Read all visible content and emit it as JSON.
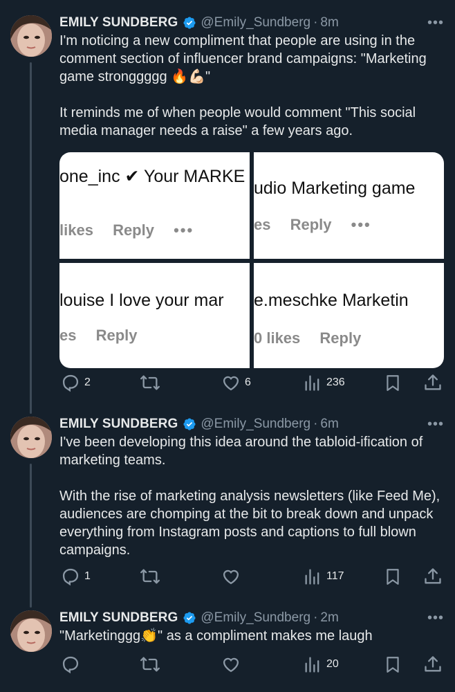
{
  "tweets": [
    {
      "name": "EMILY SUNDBERG",
      "handle": "@Emily_Sundberg",
      "dot": "·",
      "time": "8m",
      "text": "I'm noticing a new compliment that people are using in the comment section of influencer brand campaigns: \"Marketing game stronggggg 🔥💪🏻\"\n\nIt reminds me of when people would comment \"This social media manager needs a raise\" a few years ago.",
      "media": [
        {
          "comment": "one_inc ✔ Your MARKE",
          "likes": "likes",
          "reply": "Reply",
          "dots": "•••"
        },
        {
          "comment": "udio Marketing game",
          "likes": "es",
          "reply": "Reply",
          "dots": "•••"
        },
        {
          "comment": "louise I love your mar",
          "likes": "es",
          "reply": "Reply",
          "dots": ""
        },
        {
          "comment": "e.meschke Marketin",
          "likes": "0 likes",
          "reply": "Reply",
          "dots": ""
        }
      ],
      "replies": "2",
      "retweets": "",
      "likes": "6",
      "views": "236"
    },
    {
      "name": "EMILY SUNDBERG",
      "handle": "@Emily_Sundberg",
      "dot": "·",
      "time": "6m",
      "text": "I've been developing this idea around the tabloid-ification of marketing teams.\n\nWith the rise of marketing analysis newsletters (like Feed Me), audiences are chomping at the bit to break down and unpack everything from Instagram posts and captions to full blown campaigns.",
      "replies": "1",
      "retweets": "",
      "likes": "",
      "views": "117"
    },
    {
      "name": "EMILY SUNDBERG",
      "handle": "@Emily_Sundberg",
      "dot": "·",
      "time": "2m",
      "text": "\"Marketinggg👏\" as a compliment makes me laugh",
      "replies": "",
      "retweets": "",
      "likes": "",
      "views": "20"
    }
  ],
  "more_label": "•••",
  "colors": {
    "background": "#15202b",
    "text": "#e7e9ea",
    "muted": "#8b98a5",
    "verified": "#1d9bf0"
  }
}
